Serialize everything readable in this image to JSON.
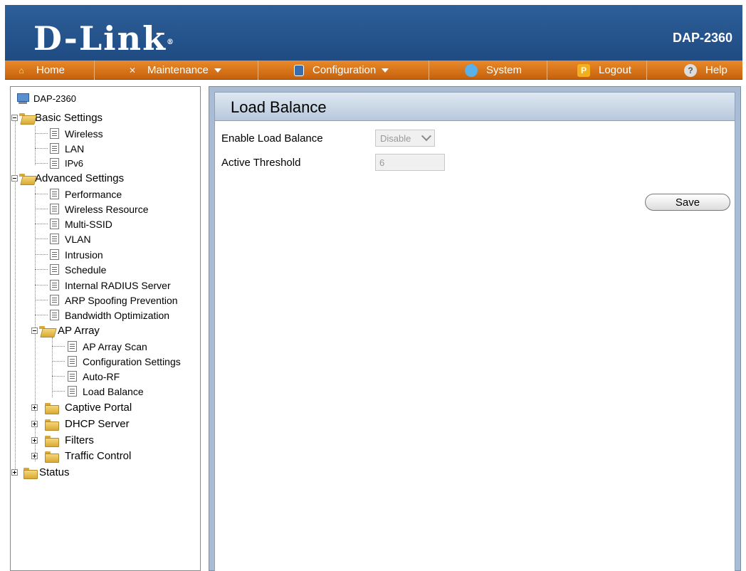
{
  "header": {
    "brand": "D-Link",
    "model": "DAP-2360"
  },
  "nav": [
    {
      "label": "Home",
      "icon": "home-icon",
      "has_caret": false
    },
    {
      "label": "Maintenance",
      "icon": "tools-icon",
      "has_caret": true
    },
    {
      "label": "Configuration",
      "icon": "save-disk-icon",
      "has_caret": true
    },
    {
      "label": "System",
      "icon": "system-icon",
      "has_caret": false
    },
    {
      "label": "Logout",
      "icon": "logout-icon",
      "has_caret": false
    },
    {
      "label": "Help",
      "icon": "help-icon",
      "has_caret": false
    }
  ],
  "tree": {
    "root": "DAP-2360",
    "basic_settings": {
      "label": "Basic Settings",
      "items": [
        "Wireless",
        "LAN",
        "IPv6"
      ]
    },
    "advanced_settings": {
      "label": "Advanced Settings",
      "items": [
        "Performance",
        "Wireless Resource",
        "Multi-SSID",
        "VLAN",
        "Intrusion",
        "Schedule",
        "Internal RADIUS Server",
        "ARP Spoofing Prevention",
        "Bandwidth Optimization"
      ],
      "ap_array": {
        "label": "AP Array",
        "items": [
          "AP Array Scan",
          "Configuration Settings",
          "Auto-RF",
          "Load Balance"
        ]
      },
      "folders": [
        "Captive Portal",
        "DHCP Server",
        "Filters",
        "Traffic Control"
      ]
    },
    "status": "Status"
  },
  "content": {
    "title": "Load Balance",
    "enable_label": "Enable Load Balance",
    "enable_value": "Disable",
    "threshold_label": "Active Threshold",
    "threshold_value": "6",
    "save_label": "Save"
  },
  "colors": {
    "header_bg": "#1f4b82",
    "nav_bg": "#d97418",
    "panel_bg": "#a9bcd3"
  }
}
